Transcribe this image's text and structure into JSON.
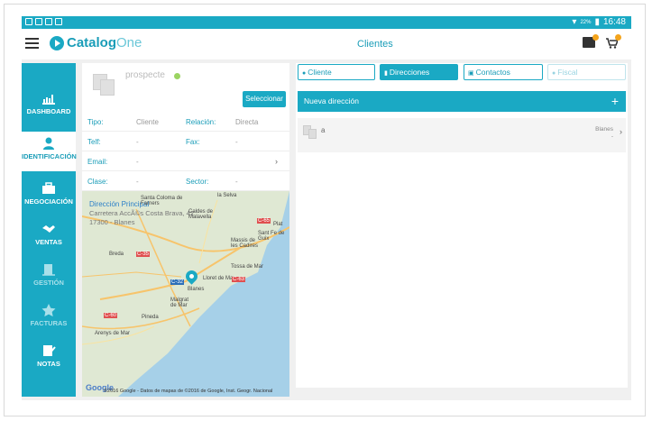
{
  "statusbar": {
    "battery": "22%",
    "time": "16:48"
  },
  "app": {
    "logo_main": "Catalog",
    "logo_sub": "One",
    "title": "Clientes"
  },
  "sidebar": {
    "items": [
      {
        "label": "DASHBOARD",
        "icon": "bar-chart-icon"
      },
      {
        "label": "IDENTIFICACIÓN",
        "icon": "person-icon"
      },
      {
        "label": "NEGOCIACIÓN",
        "icon": "briefcase-icon"
      },
      {
        "label": "VENTAS",
        "icon": "handshake-icon"
      },
      {
        "label": "GESTIÓN",
        "icon": "building-icon"
      },
      {
        "label": "FACTURAS",
        "icon": "star-icon"
      },
      {
        "label": "NOTAS",
        "icon": "notes-icon"
      }
    ]
  },
  "client": {
    "name": "prospecte",
    "select_label": "Seleccionar",
    "rows": {
      "tipo_label": "Tipo:",
      "tipo_value": "Cliente",
      "relacion_label": "Relación:",
      "relacion_value": "Directa",
      "telf_label": "Telf:",
      "telf_value": "-",
      "fax_label": "Fax:",
      "fax_value": "-",
      "email_label": "Email:",
      "email_value": "-",
      "clase_label": "Clase:",
      "clase_value": "-",
      "sector_label": "Sector:",
      "sector_value": "-"
    }
  },
  "map": {
    "address_title": "Dirección Principal",
    "address_line1": "Carretera AccÃ©s Costa Brava, 42",
    "address_line2": "17300 - Blanes",
    "labels": {
      "la_selva": "la Selva",
      "santa_coloma": "Santa Coloma de Farners",
      "caldes": "Caldes de Malavella",
      "lloret": "Lloret de Mar",
      "tossa": "Tossa de Mar",
      "blanes": "Blanes",
      "malgrat": "Malgrat de Mar",
      "pineda": "Pineda",
      "arenys": "Arenys de Mar",
      "breda": "Breda",
      "sant_feliu": "Sant Fe de Guix",
      "massis": "Massis de les Cadires",
      "c35": "C-35",
      "c32": "C-32",
      "c65": "C-65",
      "c60": "C-60",
      "c63": "C-63",
      "plat": "Plat"
    },
    "google": "Google",
    "copyright": "©2016 Google - Datos de mapas de ©2016 de Google, Inst. Geogr. Nacional"
  },
  "tabs": [
    {
      "label": "Cliente",
      "icon": "person-icon"
    },
    {
      "label": "Direcciones",
      "icon": "book-icon"
    },
    {
      "label": "Contactos",
      "icon": "contact-card-icon"
    },
    {
      "label": "Fiscal",
      "icon": "person-icon"
    }
  ],
  "addresses": {
    "new_label": "Nueva dirección",
    "plus": "+",
    "items": [
      {
        "name": "a",
        "city": "Blanes",
        "detail": "-"
      }
    ]
  },
  "colors": {
    "accent": "#1aa9c4",
    "status_green": "#9bd462",
    "badge": "#f4a41c"
  }
}
